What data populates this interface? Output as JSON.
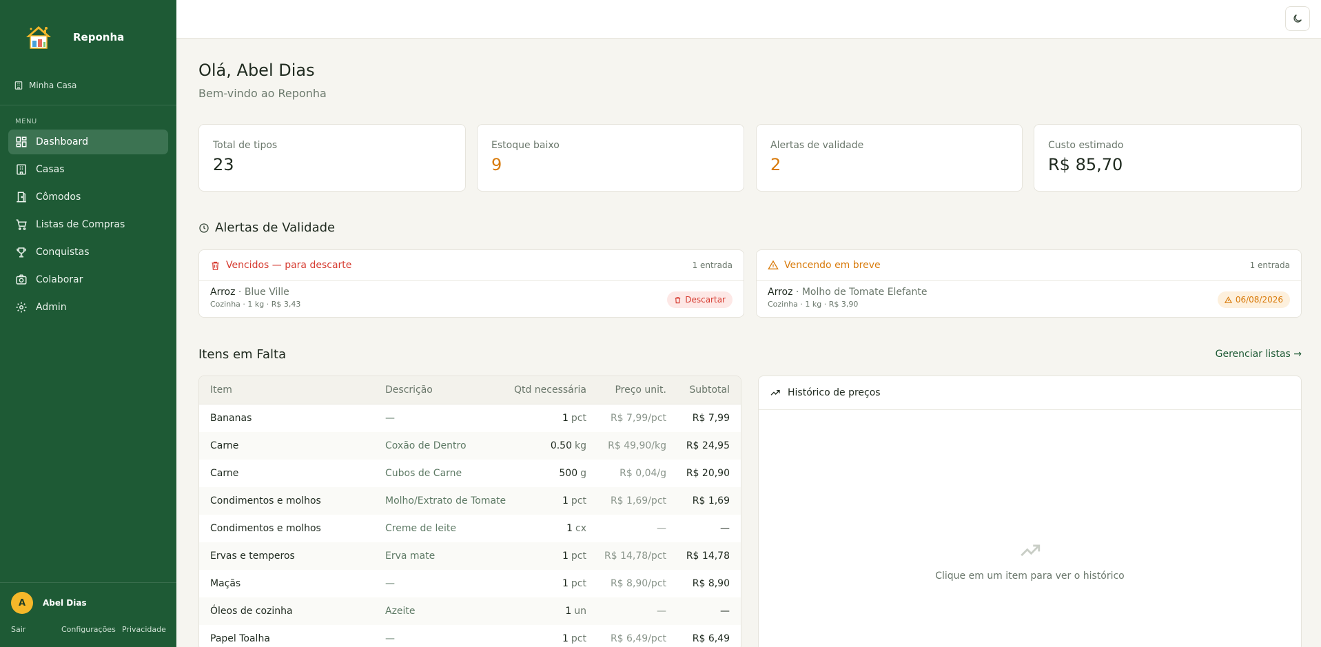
{
  "app": {
    "name": "Reponha"
  },
  "sidebar": {
    "house": "Minha Casa",
    "menu_title": "MENU",
    "items": [
      {
        "label": "Dashboard",
        "icon": "dashboard-icon",
        "active": true
      },
      {
        "label": "Casas",
        "icon": "building-icon"
      },
      {
        "label": "Cômodos",
        "icon": "door-icon"
      },
      {
        "label": "Listas de Compras",
        "icon": "cart-icon"
      },
      {
        "label": "Conquistas",
        "icon": "trophy-icon"
      },
      {
        "label": "Colaborar",
        "icon": "camera-icon"
      },
      {
        "label": "Admin",
        "icon": "gear-icon"
      }
    ],
    "user": {
      "initial": "A",
      "name": "Abel Dias"
    },
    "links": {
      "logout": "Sair",
      "settings": "Configurações",
      "privacy": "Privacidade"
    }
  },
  "header": {
    "greeting": "Olá, Abel Dias",
    "subtitle": "Bem-vindo ao Reponha"
  },
  "stats": [
    {
      "label": "Total de tipos",
      "value": "23"
    },
    {
      "label": "Estoque baixo",
      "value": "9"
    },
    {
      "label": "Alertas de validade",
      "value": "2"
    },
    {
      "label": "Custo estimado",
      "value": "R$ 85,70"
    }
  ],
  "alerts": {
    "title": "Alertas de Validade",
    "expired": {
      "title": "Vencidos — para descarte",
      "count": "1 entrada",
      "item": "Arroz",
      "sep": " · ",
      "detail": "Blue Ville",
      "meta": "Cozinha · 1 kg · R$ 3,43",
      "action": "Descartar"
    },
    "soon": {
      "title": "Vencendo em breve",
      "count": "1 entrada",
      "item": "Arroz",
      "sep": " · ",
      "detail": "Molho de Tomate Elefante",
      "meta": "Cozinha · 1 kg · R$ 3,90",
      "date": "06/08/2026"
    }
  },
  "missing": {
    "title": "Itens em Falta",
    "manage_link": "Gerenciar listas →",
    "columns": {
      "item": "Item",
      "desc": "Descrição",
      "qty": "Qtd necessária",
      "price": "Preço unit.",
      "subtotal": "Subtotal"
    },
    "rows": [
      {
        "item": "Bananas",
        "desc": "—",
        "qty": "1",
        "unit": "pct",
        "price": "R$ 7,99/pct",
        "subtotal": "R$ 7,99"
      },
      {
        "item": "Carne",
        "desc": "Coxão de Dentro",
        "qty": "0.50",
        "unit": "kg",
        "price": "R$ 49,90/kg",
        "subtotal": "R$ 24,95"
      },
      {
        "item": "Carne",
        "desc": "Cubos de Carne",
        "qty": "500",
        "unit": "g",
        "price": "R$ 0,04/g",
        "subtotal": "R$ 20,90"
      },
      {
        "item": "Condimentos e molhos",
        "desc": "Molho/Extrato de Tomate",
        "qty": "1",
        "unit": "pct",
        "price": "R$ 1,69/pct",
        "subtotal": "R$ 1,69"
      },
      {
        "item": "Condimentos e molhos",
        "desc": "Creme de leite",
        "qty": "1",
        "unit": "cx",
        "price": "—",
        "subtotal": "—"
      },
      {
        "item": "Ervas e temperos",
        "desc": "Erva mate",
        "qty": "1",
        "unit": "pct",
        "price": "R$ 14,78/pct",
        "subtotal": "R$ 14,78"
      },
      {
        "item": "Maçãs",
        "desc": "—",
        "qty": "1",
        "unit": "pct",
        "price": "R$ 8,90/pct",
        "subtotal": "R$ 8,90"
      },
      {
        "item": "Óleos de cozinha",
        "desc": "Azeite",
        "qty": "1",
        "unit": "un",
        "price": "—",
        "subtotal": "—"
      },
      {
        "item": "Papel Toalha",
        "desc": "—",
        "qty": "1",
        "unit": "pct",
        "price": "R$ 6,49/pct",
        "subtotal": "R$ 6,49"
      }
    ]
  },
  "history": {
    "title": "Histórico de preços",
    "empty": "Clique em um item para ver o histórico"
  },
  "colors": {
    "sidebar": "#1e5a35",
    "active": "#3c7352",
    "warning": "#d87a0a",
    "danger": "#d63b30",
    "avatar": "#f5b82a"
  }
}
